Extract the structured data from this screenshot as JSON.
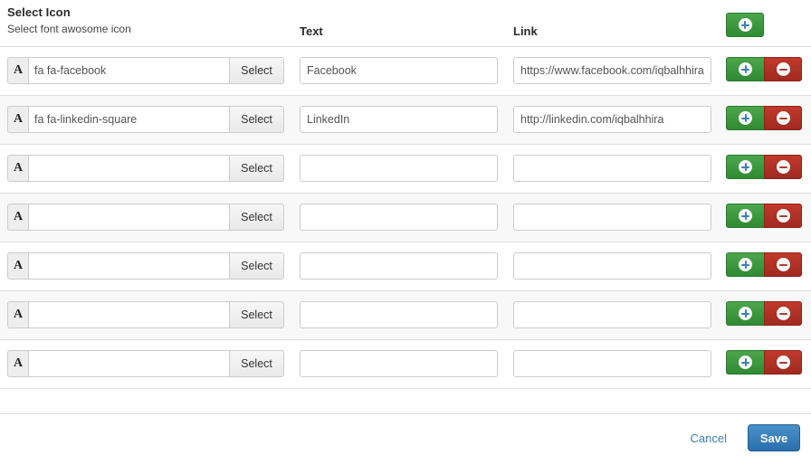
{
  "header": {
    "title": "Select Icon",
    "subtitle": "Select font awosome icon",
    "col_text": "Text",
    "col_link": "Link",
    "add_icon": "plus-circle-icon"
  },
  "icons": {
    "preview_glyph": "A",
    "plus": "plus-circle-icon",
    "minus": "minus-circle-icon"
  },
  "labels": {
    "select_button": "Select"
  },
  "colors": {
    "green": "#3a8f3e",
    "red": "#b03a2e",
    "save_blue": "#2a6fae",
    "link_blue": "#3b7fb5",
    "row_alt": "#f8f8f8",
    "border": "#dddddd"
  },
  "rows": [
    {
      "icon": "fa fa-facebook",
      "text": "Facebook",
      "link": "https://www.facebook.com/iqbalhhira"
    },
    {
      "icon": "fa fa-linkedin-square",
      "text": "LinkedIn",
      "link": "http://linkedin.com/iqbalhhira"
    },
    {
      "icon": "",
      "text": "",
      "link": ""
    },
    {
      "icon": "",
      "text": "",
      "link": ""
    },
    {
      "icon": "",
      "text": "",
      "link": ""
    },
    {
      "icon": "",
      "text": "",
      "link": ""
    },
    {
      "icon": "",
      "text": "",
      "link": ""
    }
  ],
  "footer": {
    "cancel": "Cancel",
    "save": "Save"
  }
}
